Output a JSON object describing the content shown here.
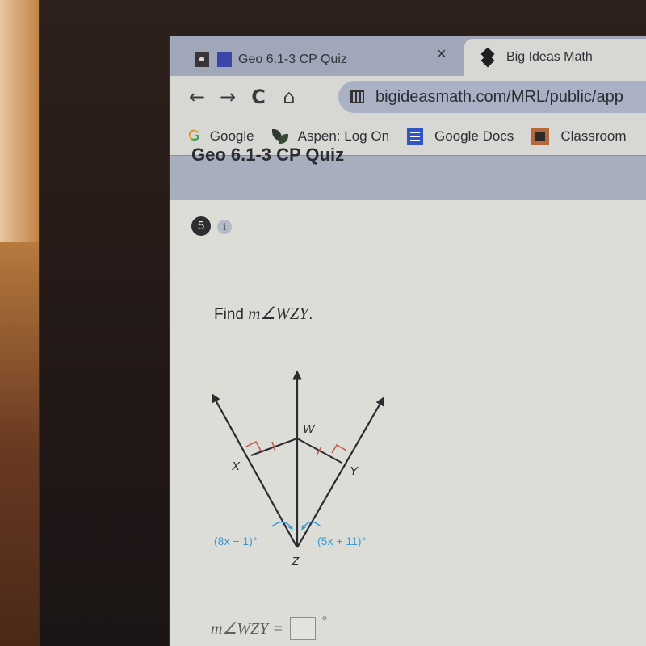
{
  "browser": {
    "tabs": [
      {
        "label": "Geo 6.1-3 CP Quiz",
        "active": false,
        "close_glyph": "×"
      },
      {
        "label": "Big Ideas Math",
        "active": true
      }
    ],
    "nav": {
      "back": "←",
      "forward": "→",
      "reload": "C",
      "home": "⌂"
    },
    "url": "bigideasmath.com/MRL/public/app",
    "bookmarks": [
      {
        "label": "Google",
        "icon": "google-icon"
      },
      {
        "label": "Aspen: Log On",
        "icon": "aspen-leaf-icon"
      },
      {
        "label": "Google Docs",
        "icon": "google-docs-icon"
      },
      {
        "label": "Classroom",
        "icon": "google-classroom-icon"
      }
    ]
  },
  "page": {
    "title": "Geo 6.1-3 CP Quiz",
    "question_number": "5",
    "info_glyph": "i",
    "prompt_prefix": "Find ",
    "prompt_math": "m∠WZY",
    "prompt_suffix": ".",
    "diagram": {
      "labels": {
        "W": "W",
        "X": "X",
        "Y": "Y",
        "Z": "Z"
      },
      "angle_left": "(8x − 1)°",
      "angle_right": "(5x + 11)°",
      "colors": {
        "line": "#2b2b30",
        "marks": "#d0504c",
        "angle": "#3b9ad6"
      }
    },
    "answer": {
      "label": "m∠WZY =",
      "value": "",
      "unit": "°"
    }
  }
}
